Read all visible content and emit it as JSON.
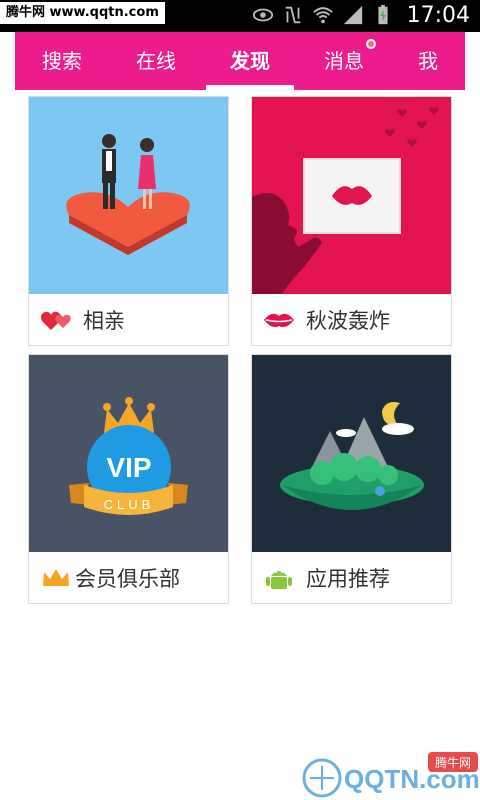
{
  "status_bar": {
    "watermark": "腾牛网 www.qqtn.com",
    "time": "17:04"
  },
  "tabs": [
    {
      "label": "搜索",
      "active": false
    },
    {
      "label": "在线",
      "active": false
    },
    {
      "label": "发现",
      "active": true
    },
    {
      "label": "消息",
      "active": false,
      "badge_dot": true
    },
    {
      "label": "我",
      "active": false
    }
  ],
  "cards": [
    {
      "label": "相亲",
      "icon": "hearts-icon"
    },
    {
      "label": "秋波轰炸",
      "icon": "lips-icon"
    },
    {
      "label": "会员俱乐部",
      "icon": "vip-crown-icon"
    },
    {
      "label": "应用推荐",
      "icon": "android-icon"
    }
  ],
  "vip_badge": {
    "text": "VIP",
    "club": "CLUB"
  },
  "bottom_watermark": {
    "brand": "QQTN.com",
    "sub": "腾牛网"
  },
  "colors": {
    "accent": "#ec1c8c",
    "blind_bg": "#7cc8f3",
    "kiss_bg": "#e3134f",
    "vip_bg": "#485465",
    "app_bg": "#1e2d3b"
  }
}
